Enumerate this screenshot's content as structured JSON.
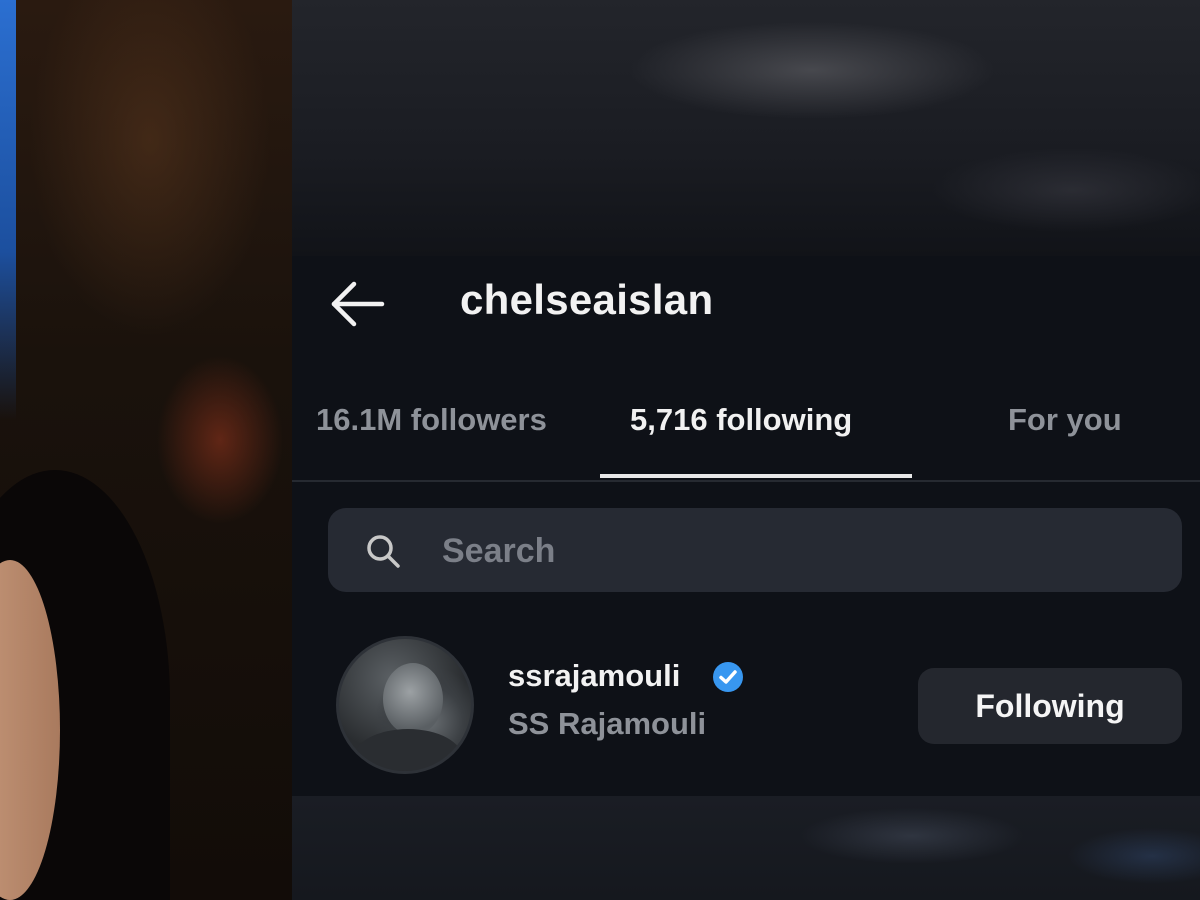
{
  "header": {
    "back_icon": "arrow-left-icon",
    "username": "chelseaislan"
  },
  "tabs": [
    {
      "label": "16.1M followers",
      "active": false
    },
    {
      "label": "5,716 following",
      "active": true
    },
    {
      "label": "For you",
      "active": false
    }
  ],
  "search": {
    "placeholder": "Search",
    "icon": "search-icon"
  },
  "list": [
    {
      "handle": "ssrajamouli",
      "verified": true,
      "name": "SS Rajamouli",
      "button_label": "Following"
    }
  ],
  "colors": {
    "background": "#0e1117",
    "search_bg": "#262a33",
    "button_bg": "#24272e",
    "verified": "#3897f0",
    "muted_text": "#8e9299"
  }
}
